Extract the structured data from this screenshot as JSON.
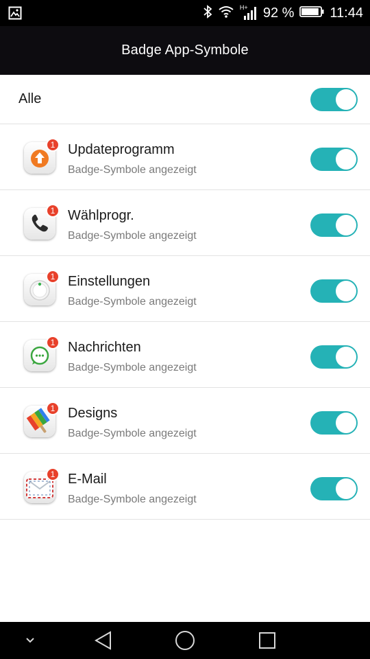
{
  "status_bar": {
    "battery_percent": "92 %",
    "time": "11:44",
    "signal_label": "H+",
    "battery_level": 0.92
  },
  "header": {
    "title": "Badge App-Symbole"
  },
  "all_row": {
    "label": "Alle",
    "enabled": true
  },
  "apps": [
    {
      "name": "Updateprogramm",
      "subtitle": "Badge-Symbole angezeigt",
      "badge": "1",
      "icon": "update-icon",
      "enabled": true
    },
    {
      "name": "Wählprogr.",
      "subtitle": "Badge-Symbole angezeigt",
      "badge": "1",
      "icon": "phone-icon",
      "enabled": true
    },
    {
      "name": "Einstellungen",
      "subtitle": "Badge-Symbole angezeigt",
      "badge": "1",
      "icon": "settings-icon",
      "enabled": true
    },
    {
      "name": "Nachrichten",
      "subtitle": "Badge-Symbole angezeigt",
      "badge": "1",
      "icon": "messages-icon",
      "enabled": true
    },
    {
      "name": "Designs",
      "subtitle": "Badge-Symbole angezeigt",
      "badge": "1",
      "icon": "themes-icon",
      "enabled": true
    },
    {
      "name": "E-Mail",
      "subtitle": "Badge-Symbole angezeigt",
      "badge": "1",
      "icon": "email-icon",
      "enabled": true
    }
  ],
  "colors": {
    "accent": "#25b2b6",
    "badge": "#e8412b",
    "header_bg": "#0d0c10"
  }
}
